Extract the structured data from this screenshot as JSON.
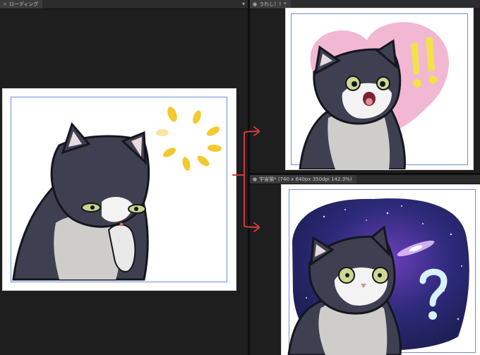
{
  "panes": {
    "left": {
      "tab": "ローディング",
      "close_icon": "×",
      "menu_icon": "chevron-down"
    },
    "top_right": {
      "tab": "うれし！！*",
      "tab_icon": "●"
    },
    "bottom_right": {
      "tab": "宇宙猫* (740 x 640px 350dpi 142.3%)",
      "tab_icon": "●"
    }
  },
  "colors": {
    "app_bg": "#1b1b1c",
    "tab_active": "#3b3b3e",
    "arrow": "#d23a3a",
    "guide": "#6f8fd6"
  }
}
